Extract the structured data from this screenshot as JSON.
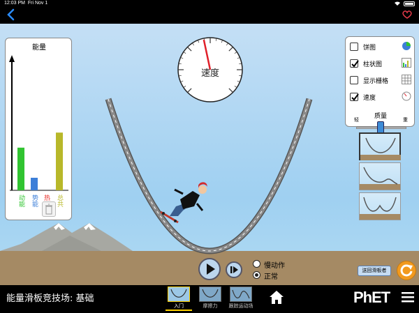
{
  "status_bar": {
    "time": "12:03 PM",
    "date": "Fri Nov 1"
  },
  "energy_chart": {
    "title": "能量",
    "bars": [
      {
        "label": "动能",
        "value": 0.34,
        "color": "#31c431"
      },
      {
        "label": "势能",
        "value": 0.1,
        "color": "#3d7fd8"
      },
      {
        "label": "热",
        "value": 0.0,
        "color": "#e8302a"
      },
      {
        "label": "总共",
        "value": 0.46,
        "color": "#b8b82a"
      }
    ]
  },
  "speedometer": {
    "label": "速度",
    "needle_fraction": 0.04
  },
  "controls": {
    "checkboxes": [
      {
        "label": "饼图",
        "checked": false,
        "icon": "pie-chart-icon"
      },
      {
        "label": "柱状图",
        "checked": true,
        "icon": "bar-chart-icon"
      },
      {
        "label": "显示栅格",
        "checked": false,
        "icon": "grid-icon"
      },
      {
        "label": "速度",
        "checked": true,
        "icon": "speedometer-icon"
      }
    ],
    "mass": {
      "title": "质量",
      "light_label": "轻",
      "heavy_label": "重",
      "value": 0.5
    }
  },
  "playback": {
    "slow_label": "慢动作",
    "normal_label": "正常",
    "selected": "normal"
  },
  "return_skater_label": "送回滑板者",
  "bottom_bar": {
    "sim_title": "能量滑板竞技场: 基础",
    "tabs": [
      {
        "label": "入门",
        "active": true
      },
      {
        "label": "摩擦力",
        "active": false
      },
      {
        "label": "跟踪运动场",
        "active": false
      }
    ],
    "logo": "PhET"
  }
}
